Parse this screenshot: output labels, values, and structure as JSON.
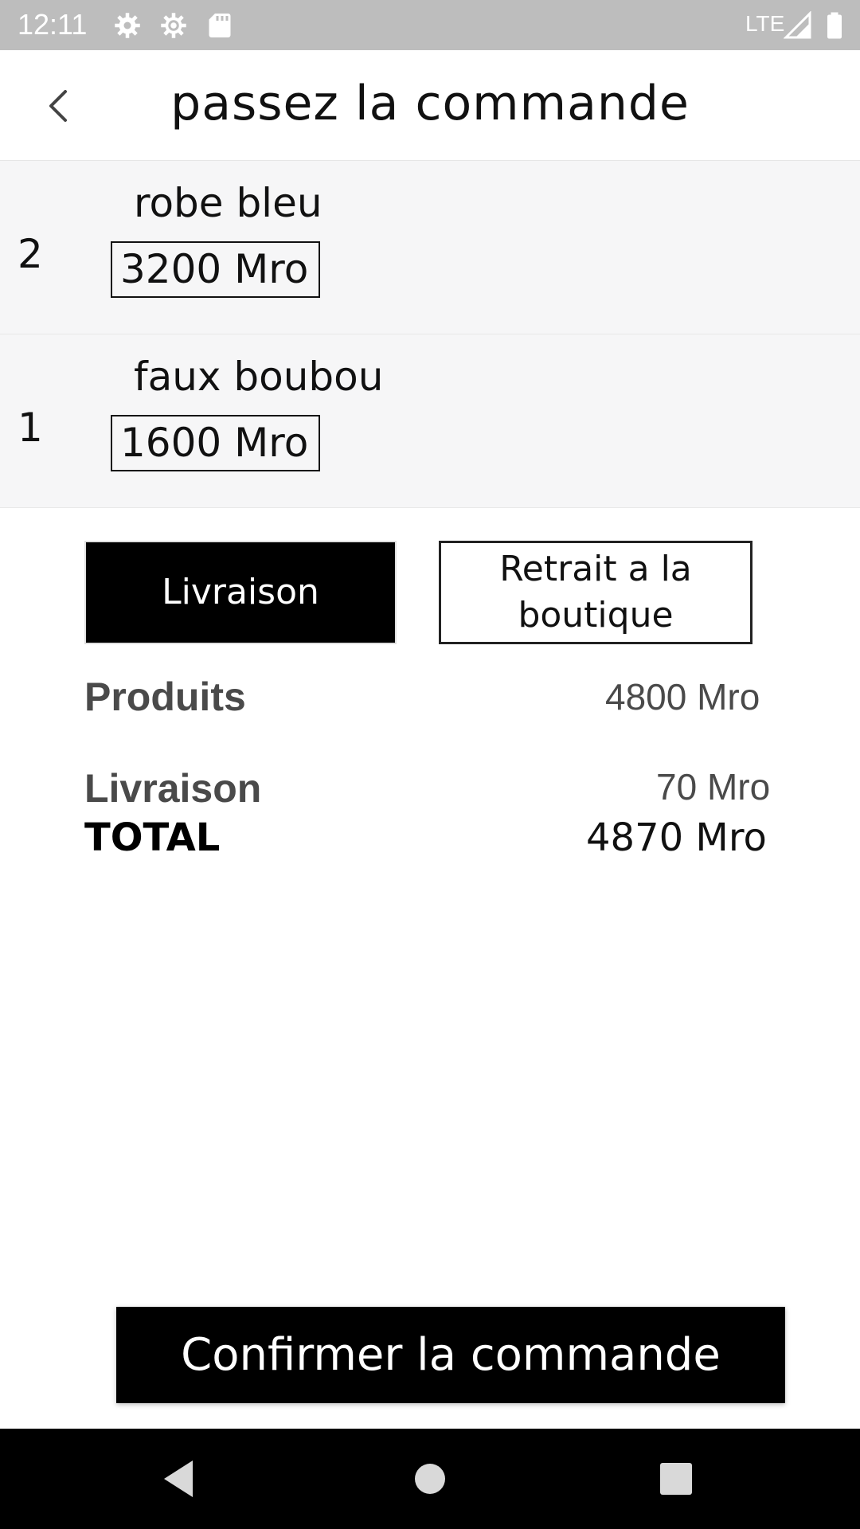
{
  "status_bar": {
    "time": "12:11",
    "network": "LTE",
    "icons": [
      "settings-icon",
      "settings-icon",
      "sd-card-icon",
      "signal-icon",
      "battery-icon"
    ]
  },
  "header": {
    "title": "passez la commande",
    "back_icon": "chevron-left-icon"
  },
  "items": [
    {
      "qty": "2",
      "name": "robe bleu",
      "price": "3200 Mro"
    },
    {
      "qty": "1",
      "name": "faux boubou",
      "price": "1600 Mro"
    }
  ],
  "delivery_options": {
    "delivery_label": "Livraison",
    "pickup_label": "Retrait a la boutique",
    "selected": "delivery"
  },
  "summary": {
    "products_label": "Produits",
    "products_value": "4800 Mro",
    "delivery_label": "Livraison",
    "delivery_value": "70 Mro",
    "total_label": "TOTAL",
    "total_value": "4870 Mro"
  },
  "confirm": {
    "label": "Confirmer la commande"
  },
  "nav": {
    "icons": [
      "back-triangle-icon",
      "home-circle-icon",
      "recents-square-icon"
    ]
  },
  "colors": {
    "status_bar": "#bdbdbd",
    "item_background": "#f6f6f7",
    "primary": "#000000"
  }
}
